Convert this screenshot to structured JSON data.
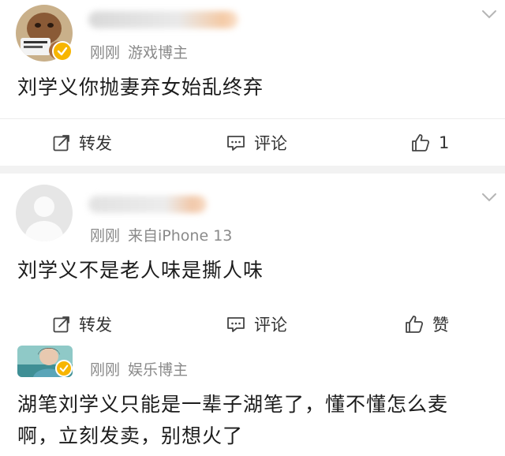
{
  "posts": [
    {
      "time": "刚刚",
      "source": "游戏博主",
      "content": "刘学义你抛妻弃女始乱终弃",
      "actions": {
        "repost": "转发",
        "comment": "评论",
        "like": "1"
      }
    },
    {
      "time": "刚刚",
      "source": "来自iPhone 13",
      "content": "刘学义不是老人味是撕人味",
      "actions": {
        "repost": "转发",
        "comment": "评论",
        "like": "赞"
      }
    },
    {
      "time": "刚刚",
      "source": "娱乐博主",
      "content_line1": "湖笔刘学义只能是一辈子湖笔了，懂不懂怎么麦",
      "content_line2": "啊，立刻发卖，别想火了"
    }
  ],
  "colors": {
    "verified": "#f7b500",
    "meta_text": "#8a8a8a",
    "divider": "#f2f2f2"
  }
}
